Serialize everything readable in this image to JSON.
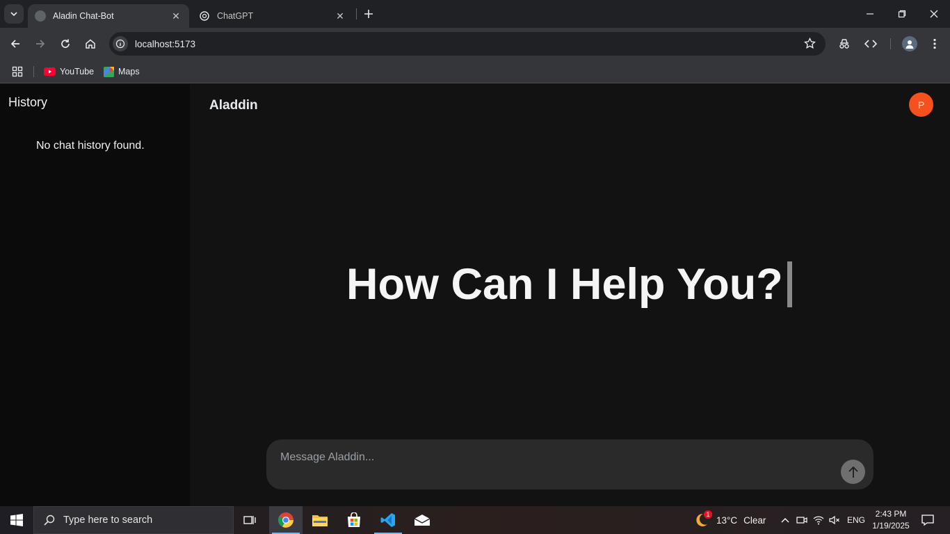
{
  "browser": {
    "tabs": [
      {
        "title": "Aladin Chat-Bot",
        "active": true
      },
      {
        "title": "ChatGPT",
        "active": false
      }
    ],
    "url": "localhost:5173",
    "bookmarks": [
      {
        "label": "YouTube",
        "icon": "youtube-icon"
      },
      {
        "label": "Maps",
        "icon": "maps-icon"
      }
    ]
  },
  "sidebar": {
    "heading": "History",
    "empty_message": "No chat history found."
  },
  "main": {
    "brand": "Aladdin",
    "avatar_initial": "P",
    "hero": "How Can I Help You?",
    "composer": {
      "placeholder": "Message Aladdin...",
      "value": ""
    }
  },
  "taskbar": {
    "search_placeholder": "Type here to search",
    "weather": {
      "temp": "13°C",
      "condition": "Clear",
      "badge": "1"
    },
    "language": "ENG",
    "time": "2:43 PM",
    "date": "1/19/2025"
  },
  "colors": {
    "sidebar_bg": "#0b0b0b",
    "main_bg": "#121212",
    "avatar": "#f4511e",
    "composer_bg": "#2a2a2a",
    "send_button": "#6f6f6f"
  }
}
